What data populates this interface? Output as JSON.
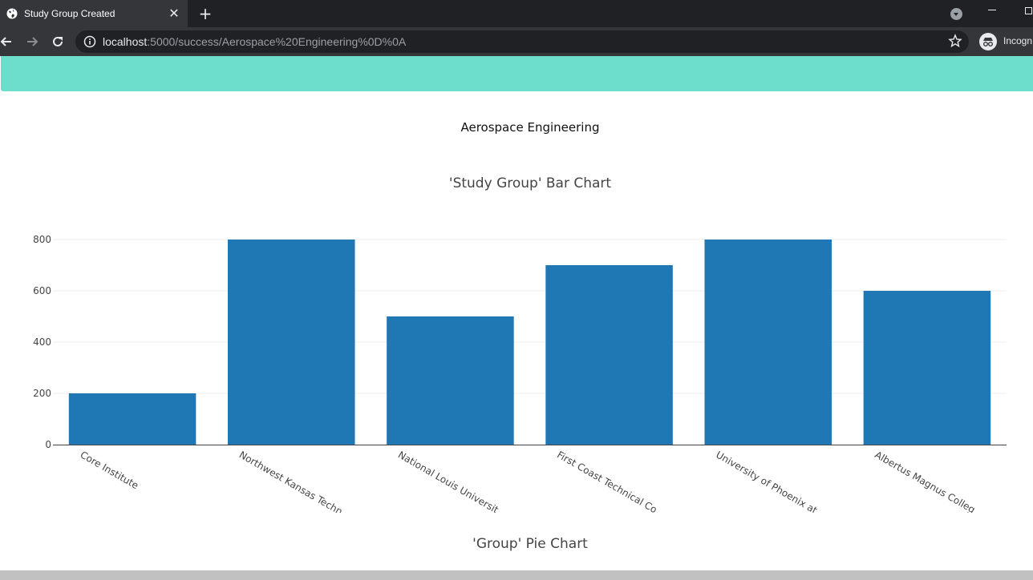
{
  "browser": {
    "tab_title": "Study Group Created",
    "url_host": "localhost",
    "url_path": ":5000/success/Aerospace%20Engineering%0D%0A",
    "incognito_label": "Incogn"
  },
  "page": {
    "subject": "Aerospace Engineering",
    "pie_title": "'Group' Pie Chart"
  },
  "colors": {
    "banner": "#6ddecb",
    "bar": "#1f77b4"
  },
  "icons": [
    "globe-icon",
    "close-icon",
    "plus-icon",
    "tab-search-icon",
    "back-arrow-icon",
    "forward-arrow-icon",
    "reload-icon",
    "info-icon",
    "star-icon",
    "incognito-icon"
  ],
  "chart_data": {
    "type": "bar",
    "title": "'Study Group' Bar Chart",
    "categories": [
      "Core Institute",
      "Northwest Kansas Techn",
      "National Louis Universit",
      "First Coast Technical Co",
      "University of Phoenix at",
      "Albertus Magnus Colleg"
    ],
    "values": [
      200,
      800,
      500,
      700,
      800,
      600
    ],
    "yticks": [
      0,
      200,
      400,
      600,
      800
    ],
    "ylim": [
      0,
      800
    ],
    "grid": true
  }
}
